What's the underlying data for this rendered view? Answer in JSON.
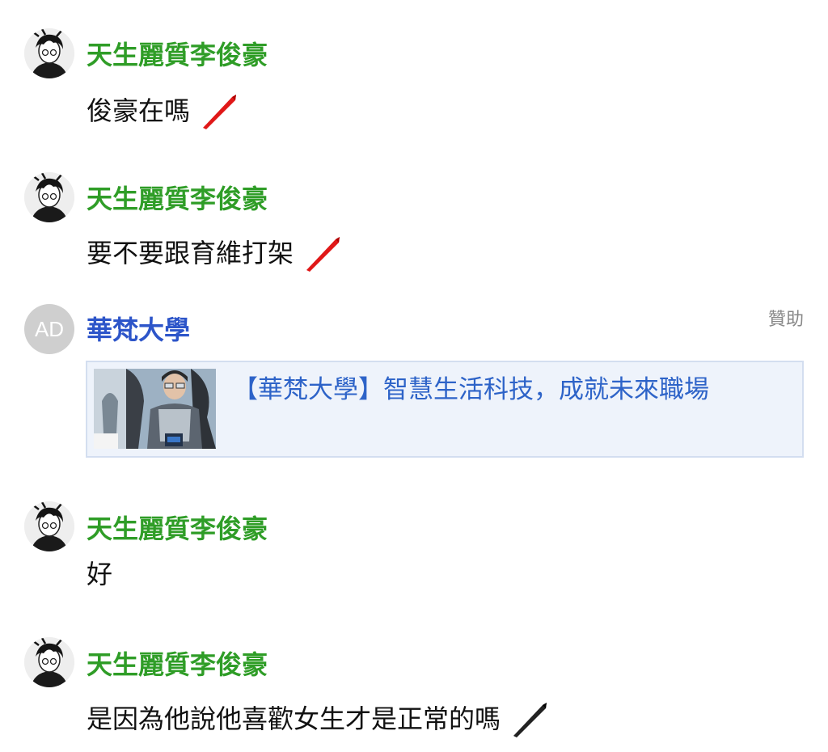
{
  "posts": [
    {
      "author": "天生麗質李俊豪",
      "message": "俊豪在嗎",
      "horn": "red-horn-icon",
      "horn_color": "#e01818"
    },
    {
      "author": "天生麗質李俊豪",
      "message": "要不要跟育維打架",
      "horn": "red-horn-icon",
      "horn_color": "#e01818"
    },
    {
      "author": "天生麗質李俊豪",
      "message": "好"
    },
    {
      "author": "天生麗質李俊豪",
      "message": "是因為他說他喜歡女生才是正常的嗎",
      "horn": "black-horn-icon",
      "horn_color": "#222222"
    }
  ],
  "ad": {
    "avatar_text": "AD",
    "advertiser": "華梵大學",
    "sponsored_label": "贊助",
    "title": "【華梵大學】智慧生活科技，成就未來職場",
    "thumbnail_icon": "ad-thumbnail-image"
  },
  "colors": {
    "author": "#2f9d27",
    "ad_author": "#2d55c9",
    "ad_title": "#2d63c8",
    "ad_card_bg": "#eef3fb",
    "ad_card_border": "#d3def0"
  }
}
